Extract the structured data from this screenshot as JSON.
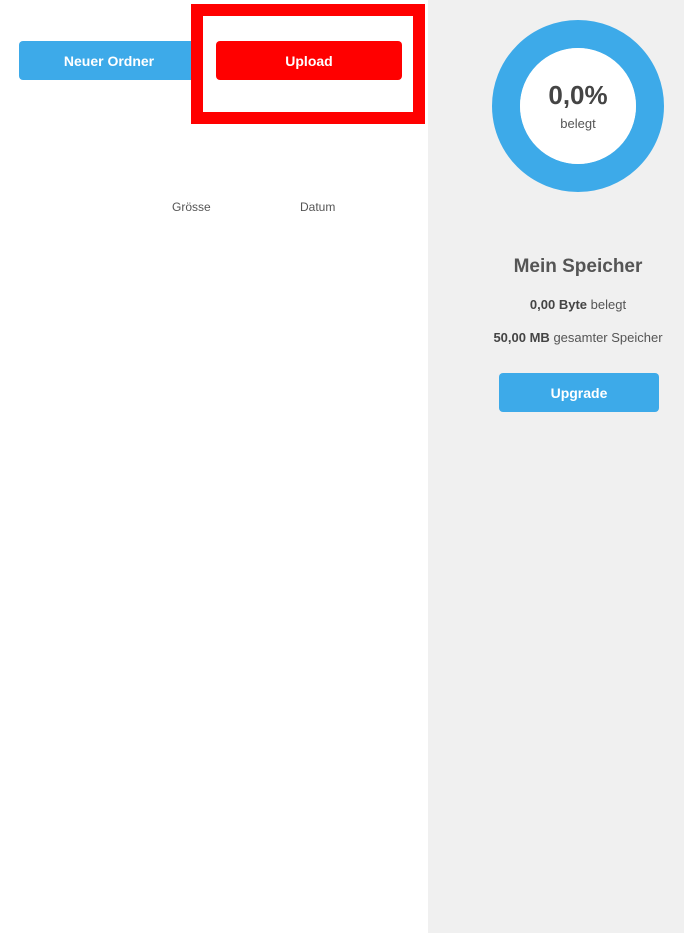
{
  "toolbar": {
    "new_folder_label": "Neuer Ordner",
    "upload_label": "Upload"
  },
  "file_list": {
    "columns": [
      "Grösse",
      "Datum"
    ]
  },
  "storage": {
    "percent_used": "0,0%",
    "percent_used_value": 0.0,
    "percent_label": "belegt",
    "title": "Mein Speicher",
    "used_amount": "0,00 Byte",
    "used_suffix": "belegt",
    "total_amount": "50,00 MB",
    "total_suffix": "gesamter Speicher",
    "upgrade_label": "Upgrade"
  },
  "colors": {
    "primary_blue": "#3daae9",
    "upload_red": "#ff0000",
    "highlight_red": "#ff0000",
    "panel_bg": "#f0f0f0",
    "text_gray": "#555555"
  }
}
